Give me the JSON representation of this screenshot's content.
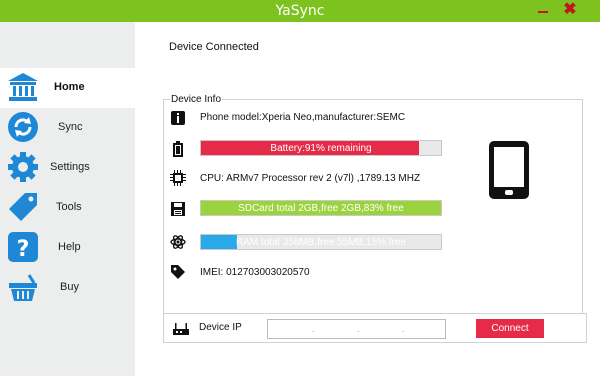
{
  "app": {
    "title": "YaSync"
  },
  "window": {
    "minimize_icon": "minimize-icon",
    "close_icon": "close-icon"
  },
  "sidebar": {
    "items": [
      {
        "label": "Home",
        "icon": "bank-icon",
        "color": "#1e88d6",
        "active": true
      },
      {
        "label": "Sync",
        "icon": "sync-icon",
        "color": "#1e88d6"
      },
      {
        "label": "Settings",
        "icon": "gear-icon",
        "color": "#1e88d6"
      },
      {
        "label": "Tools",
        "icon": "tag-icon",
        "color": "#1e88d6"
      },
      {
        "label": "Help",
        "icon": "help-icon",
        "color": "#1e88d6"
      },
      {
        "label": "Buy",
        "icon": "basket-icon",
        "color": "#1e88d6"
      }
    ]
  },
  "status": {
    "text": "Device Connected"
  },
  "device_info": {
    "title": "Device Info",
    "phone_model": "Phone model:Xperia Neo,manufacturer:SEMC",
    "battery": {
      "text": "Battery:91% remaining",
      "percent": 91,
      "color": "#e52b48"
    },
    "cpu": "CPU: ARMv7 Processor rev 2 (v7l) ,1789.13 MHZ",
    "sdcard": {
      "text": "SDCard total 2GB,free 2GB,83% free",
      "percent": 100,
      "color": "#9bd33f"
    },
    "ram": {
      "text": "RAM total 358MB,free 55MB,15% free",
      "percent": 15,
      "color": "#29a9ea"
    },
    "imei": "IMEI: 012703003020570"
  },
  "device_ip": {
    "label": "Device IP",
    "value": "",
    "connect_label": "Connect"
  },
  "colors": {
    "accent": "#7dc21e",
    "danger": "#e52b48",
    "nav_blue": "#1e88d6"
  }
}
